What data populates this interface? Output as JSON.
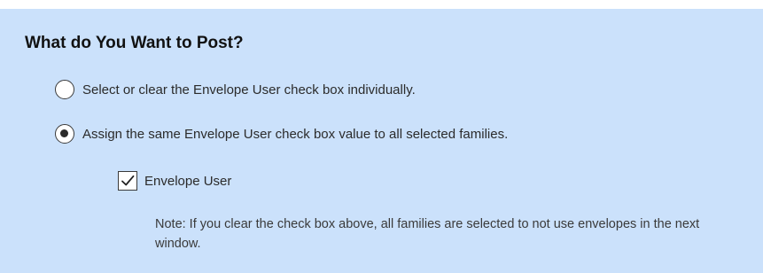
{
  "section": {
    "heading": "What do You Want to Post?"
  },
  "options": [
    {
      "label": "Select or clear the Envelope User check box individually.",
      "selected": false
    },
    {
      "label": "Assign the same Envelope User check box value to all selected families.",
      "selected": true
    }
  ],
  "envelope_checkbox": {
    "label": "Envelope User",
    "checked": true
  },
  "note": {
    "text": "Note: If you clear the check box above, all families are selected to not use envelopes in the next window."
  },
  "colors": {
    "panel_background": "#cbe1fb",
    "text": "#2b2b2b"
  }
}
